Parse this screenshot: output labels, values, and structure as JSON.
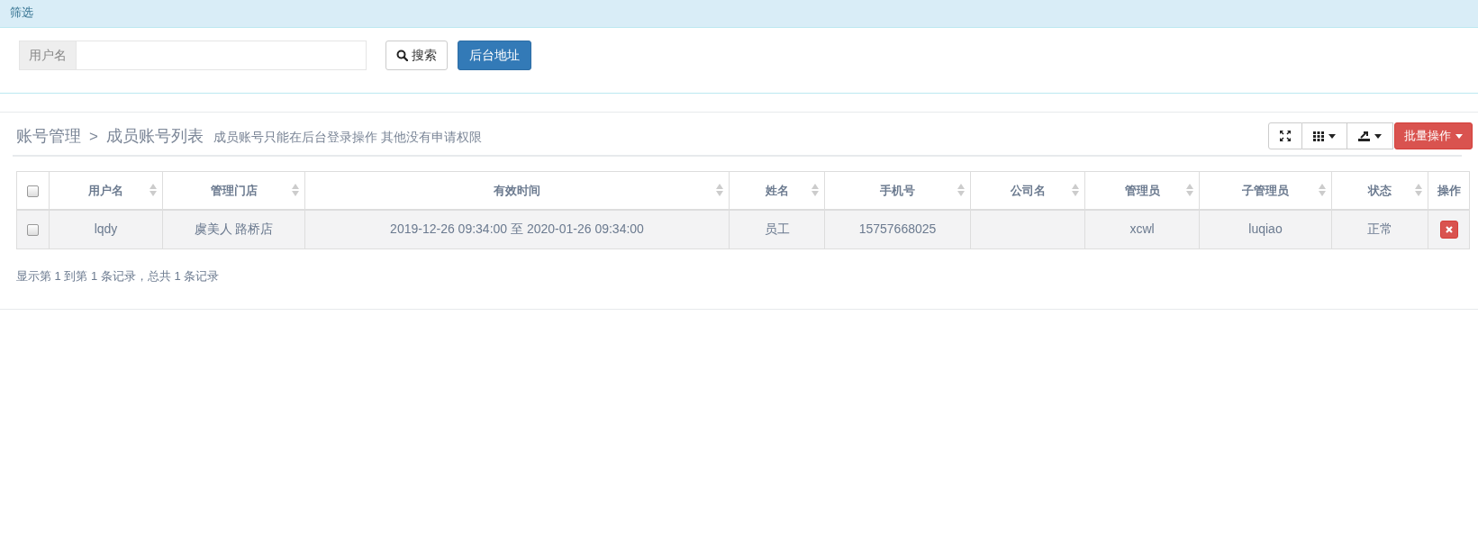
{
  "filter_panel": {
    "title": "筛选",
    "field": {
      "label": "用户名"
    },
    "buttons": [
      {
        "kind": "search",
        "label": "搜索"
      },
      {
        "kind": "primary",
        "label": "后台地址"
      }
    ]
  },
  "list_panel": {
    "breadcrumb": [
      "账号管理",
      "成员账号列表"
    ],
    "separator": ">",
    "note": "成员账号只能在后台登录操作 其他没有申请权限",
    "toolbar": [
      {
        "kind": "fullscreen",
        "dropdown": false
      },
      {
        "kind": "columns",
        "dropdown": true
      },
      {
        "kind": "export",
        "dropdown": true
      },
      {
        "kind": "batch",
        "label": "批量操作",
        "dropdown": true
      }
    ],
    "table": {
      "select_all": {
        "checked": false
      },
      "columns": [
        {
          "label": "用户名",
          "sortable": true
        },
        {
          "label": "管理门店",
          "sortable": true
        },
        {
          "label": "有效时间",
          "sortable": true
        },
        {
          "label": "姓名",
          "sortable": true
        },
        {
          "label": "手机号",
          "sortable": true
        },
        {
          "label": "公司名",
          "sortable": true
        },
        {
          "label": "管理员",
          "sortable": true
        },
        {
          "label": "子管理员",
          "sortable": true
        },
        {
          "label": "状态",
          "sortable": true
        },
        {
          "label": "操作",
          "sortable": false
        }
      ],
      "rows": [
        {
          "checked": false,
          "cells": [
            "lqdy",
            "虞美人 路桥店",
            "2019-12-26 09:34:00 至 2020-01-26 09:34:00",
            "员工",
            "15757668025",
            "",
            "xcwl",
            "luqiao",
            "正常"
          ]
        }
      ]
    },
    "footer": "显示第 1 到第 1 条记录，总共 1 条记录"
  }
}
